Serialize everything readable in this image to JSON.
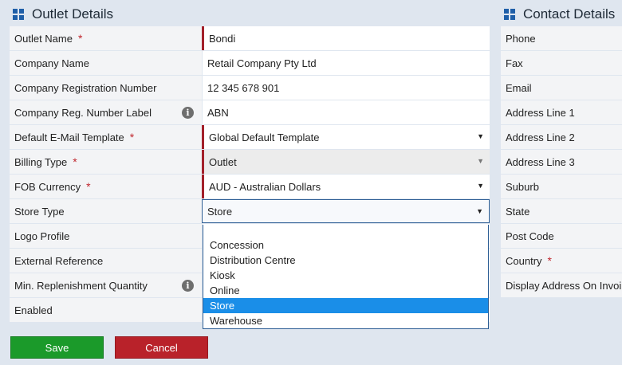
{
  "outlet_panel": {
    "title": "Outlet Details",
    "rows": [
      {
        "label": "Outlet Name",
        "required": true,
        "value": "Bondi",
        "type": "text"
      },
      {
        "label": "Company Name",
        "required": false,
        "value": "Retail Company Pty Ltd",
        "type": "text"
      },
      {
        "label": "Company Registration Number",
        "required": false,
        "value": "12 345 678 901",
        "type": "text"
      },
      {
        "label": "Company Reg. Number Label",
        "required": false,
        "info": true,
        "value": "ABN",
        "type": "text"
      },
      {
        "label": "Default E-Mail Template",
        "required": true,
        "value": "Global Default Template",
        "type": "select"
      },
      {
        "label": "Billing Type",
        "required": true,
        "value": "Outlet",
        "type": "select-disabled"
      },
      {
        "label": "FOB Currency",
        "required": true,
        "value": "AUD - Australian Dollars",
        "type": "select"
      },
      {
        "label": "Store Type",
        "required": false,
        "value": "Store",
        "type": "select-open"
      },
      {
        "label": "Logo Profile",
        "required": false,
        "value": "",
        "type": "text"
      },
      {
        "label": "External Reference",
        "required": false,
        "value": "",
        "type": "text"
      },
      {
        "label": "Min. Replenishment Quantity",
        "required": false,
        "info": true,
        "value": "",
        "type": "text"
      },
      {
        "label": "Enabled",
        "required": false,
        "value": "",
        "type": "text"
      }
    ],
    "required_marker": "*",
    "info_glyph": "i"
  },
  "store_type_dropdown": {
    "options": [
      "Concession",
      "Distribution Centre",
      "Kiosk",
      "Online",
      "Store",
      "Warehouse"
    ],
    "selected": "Store"
  },
  "contact_panel": {
    "title": "Contact Details",
    "rows": [
      {
        "label": "Phone",
        "required": false
      },
      {
        "label": "Fax",
        "required": false
      },
      {
        "label": "Email",
        "required": false
      },
      {
        "label": "Address Line 1",
        "required": false
      },
      {
        "label": "Address Line 2",
        "required": false
      },
      {
        "label": "Address Line 3",
        "required": false
      },
      {
        "label": "Suburb",
        "required": false
      },
      {
        "label": "State",
        "required": false
      },
      {
        "label": "Post Code",
        "required": false
      },
      {
        "label": "Country",
        "required": true
      },
      {
        "label": "Display Address On Invoi",
        "required": false
      }
    ]
  },
  "footer": {
    "save_label": "Save",
    "cancel_label": "Cancel"
  },
  "colors": {
    "accent": "#1f5fa8",
    "required": "#a3202a",
    "save": "#1b9a2a",
    "cancel": "#b9222a",
    "selected_option": "#1a8ee8"
  },
  "icons": {
    "panel": "grid-icon",
    "info": "info-icon",
    "caret": "caret-down-icon"
  }
}
